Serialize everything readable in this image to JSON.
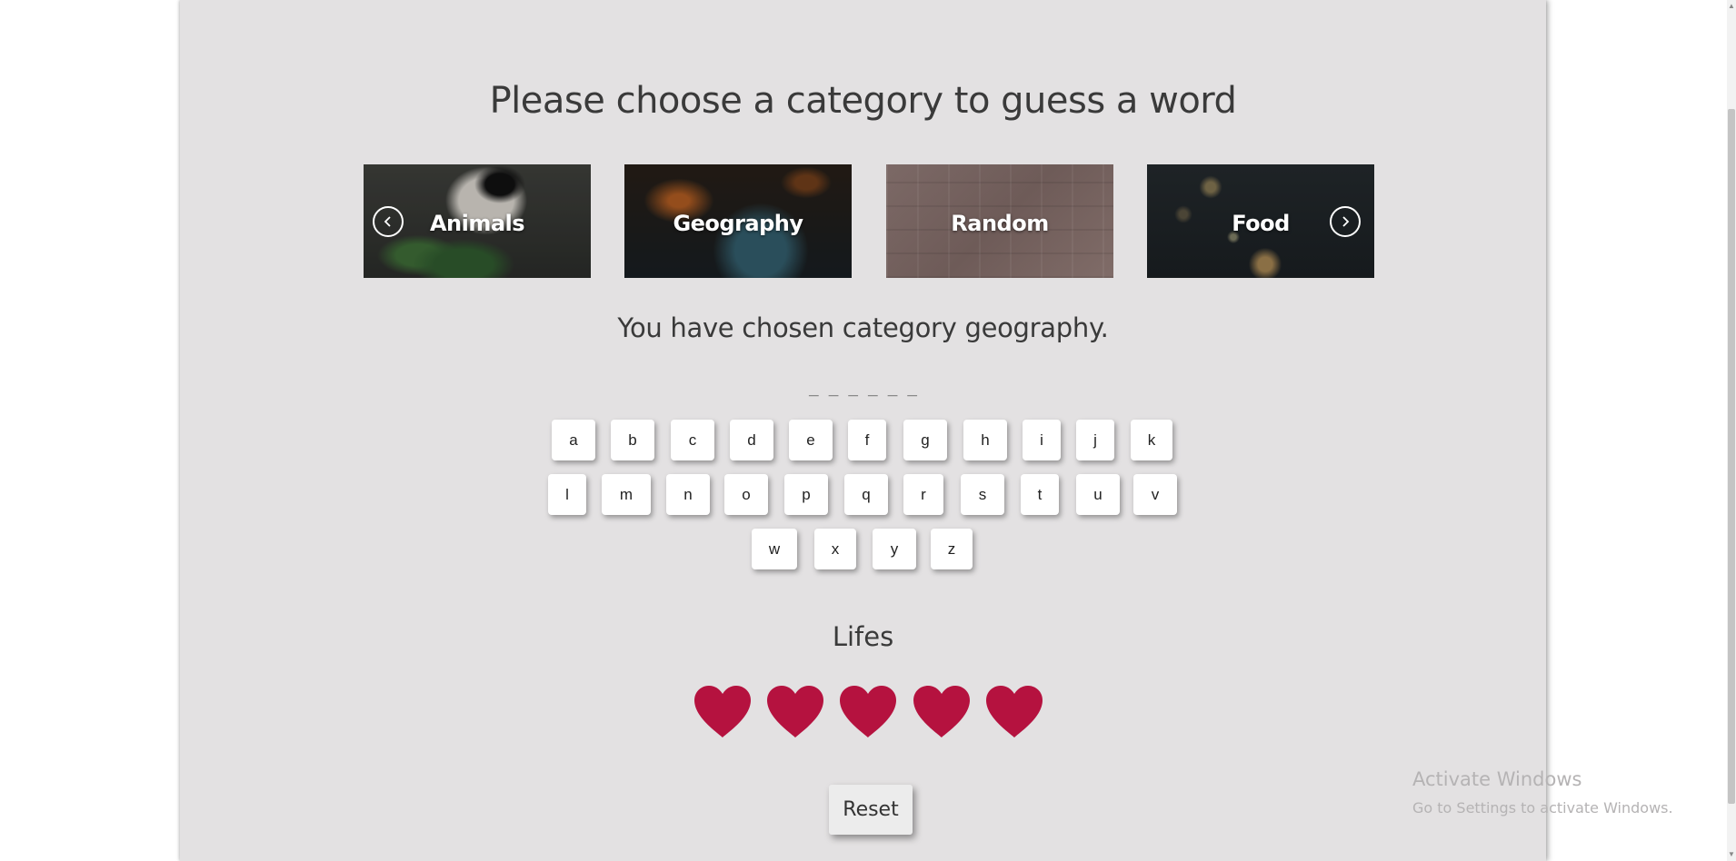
{
  "header": {
    "title": "Please choose a category to guess a word"
  },
  "carousel": {
    "categories": [
      {
        "label": "Animals",
        "image": "panda"
      },
      {
        "label": "Geography",
        "image": "globe"
      },
      {
        "label": "Random",
        "image": "books"
      },
      {
        "label": "Food",
        "image": "tea-table"
      }
    ],
    "prev_icon": "chevron-left-icon",
    "next_icon": "chevron-right-icon"
  },
  "game": {
    "chosen_text": "You have chosen category geography.",
    "word_display": "_ _ _ _ _ _",
    "keyboard": {
      "row1": [
        "a",
        "b",
        "c",
        "d",
        "e",
        "f",
        "g",
        "h",
        "i",
        "j",
        "k"
      ],
      "row2": [
        "l",
        "m",
        "n",
        "o",
        "p",
        "q",
        "r",
        "s",
        "t",
        "u",
        "v"
      ],
      "row3": [
        "w",
        "x",
        "y",
        "z"
      ]
    },
    "lifes_label": "Lifes",
    "lifes_count": 5,
    "heart_color": "#b5123f",
    "reset_label": "Reset"
  },
  "system": {
    "watermark_title": "Activate Windows",
    "watermark_sub": "Go to Settings to activate Windows."
  }
}
